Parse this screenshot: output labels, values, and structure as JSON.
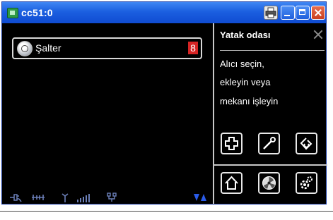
{
  "window": {
    "title": "cc51:0"
  },
  "device_list": {
    "items": [
      {
        "label": "Şalter",
        "badge": "8"
      }
    ]
  },
  "panel": {
    "title": "Yatak odası",
    "message_lines": [
      "Alıcı seçin,",
      "ekleyin veya",
      "mekanı işleyin"
    ],
    "buttons_row1": [
      "add-icon",
      "wrench-icon",
      "refresh-icon"
    ],
    "buttons_row2": [
      "home-icon",
      "fan-icon",
      "settings-icon"
    ]
  },
  "status_bar": {
    "icons": [
      "plug-icon",
      "link-icon",
      "antenna-icon",
      "signal-bars-icon",
      "network-icon",
      "triangles-icon"
    ]
  },
  "colors": {
    "title_bar": "#1b5fe0",
    "badge": "#d62424",
    "status_icons": "#6b7fb8"
  }
}
